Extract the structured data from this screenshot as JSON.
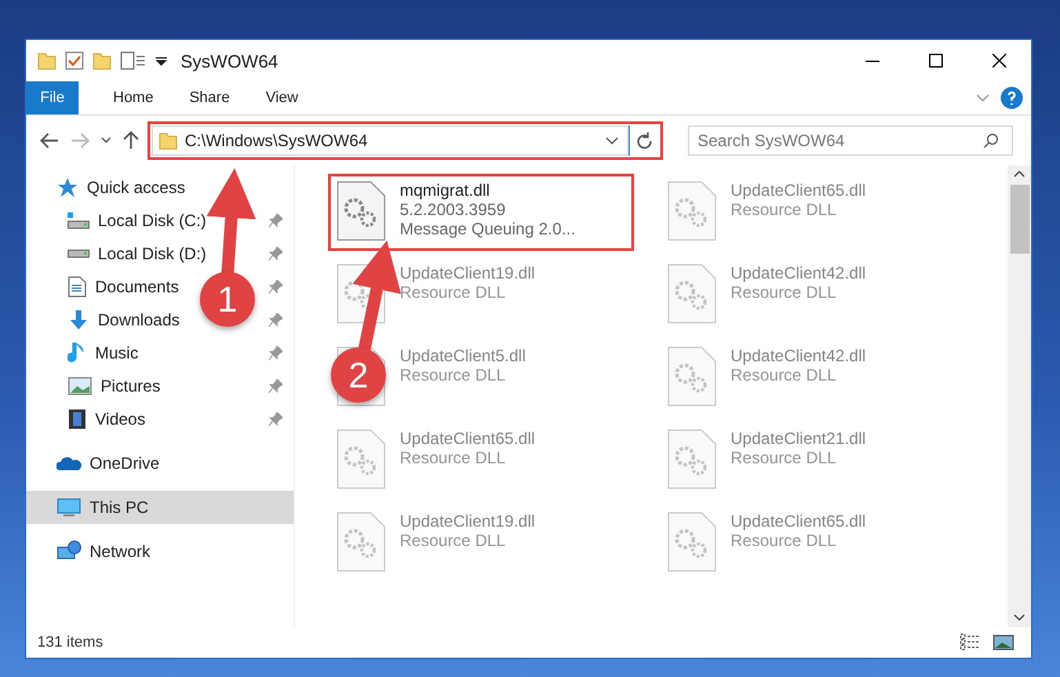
{
  "window": {
    "title": "SysWOW64"
  },
  "ribbon": {
    "file_button": "File",
    "tabs": [
      "Home",
      "Share",
      "View"
    ]
  },
  "address": {
    "path": "C:\\Windows\\SysWOW64",
    "highlighted": true
  },
  "search": {
    "placeholder": "Search SysWOW64"
  },
  "sidebar": {
    "items": [
      {
        "label": "Quick access",
        "selected": false,
        "children": [
          {
            "label": "Local Disk (C:)",
            "pinned": true,
            "selected": false
          },
          {
            "label": "Local Disk (D:)",
            "pinned": true,
            "selected": false
          },
          {
            "label": "Documents",
            "pinned": true,
            "selected": false
          },
          {
            "label": "Downloads",
            "pinned": true,
            "selected": false
          },
          {
            "label": "Music",
            "pinned": true,
            "selected": false
          },
          {
            "label": "Pictures",
            "pinned": true,
            "selected": false
          },
          {
            "label": "Videos",
            "pinned": true,
            "selected": false
          }
        ]
      },
      {
        "label": "OneDrive",
        "selected": false
      },
      {
        "label": "This PC",
        "selected": true
      },
      {
        "label": "Network",
        "selected": false
      }
    ]
  },
  "files": [
    {
      "name": "mqmigrat.dll",
      "details": [
        "5.2.2003.3959",
        "Message Queuing 2.0..."
      ],
      "blurred": false,
      "highlighted": true
    },
    {
      "name": "UpdateClient65.dll",
      "details": [
        "Resource DLL"
      ],
      "blurred": true,
      "highlighted": false
    },
    {
      "name": "UpdateClient19.dll",
      "details": [
        "Resource DLL"
      ],
      "blurred": true,
      "highlighted": false
    },
    {
      "name": "UpdateClient42.dll",
      "details": [
        "Resource DLL"
      ],
      "blurred": true,
      "highlighted": false
    },
    {
      "name": "UpdateClient5.dll",
      "details": [
        "Resource DLL"
      ],
      "blurred": true,
      "highlighted": false
    },
    {
      "name": "UpdateClient42.dll",
      "details": [
        "Resource DLL"
      ],
      "blurred": true,
      "highlighted": false
    },
    {
      "name": "UpdateClient65.dll",
      "details": [
        "Resource DLL"
      ],
      "blurred": true,
      "highlighted": false
    },
    {
      "name": "UpdateClient21.dll",
      "details": [
        "Resource DLL"
      ],
      "blurred": true,
      "highlighted": false
    },
    {
      "name": "UpdateClient19.dll",
      "details": [
        "Resource DLL"
      ],
      "blurred": true,
      "highlighted": false
    },
    {
      "name": "UpdateClient65.dll",
      "details": [
        "Resource DLL"
      ],
      "blurred": true,
      "highlighted": false
    }
  ],
  "callouts": [
    {
      "label": "1"
    },
    {
      "label": "2"
    }
  ],
  "status_bar": {
    "count": "131 items"
  }
}
